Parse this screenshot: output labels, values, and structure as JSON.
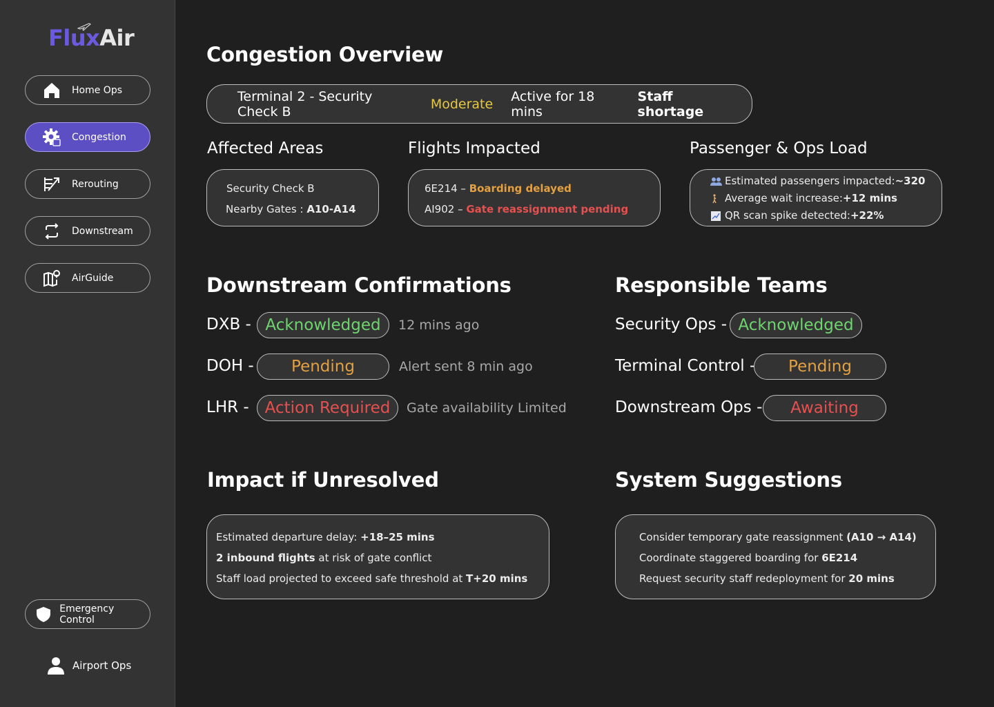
{
  "brand": {
    "flux": "Flux",
    "air": "Air"
  },
  "nav": {
    "home": "Home Ops",
    "congestion": "Congestion",
    "rerouting": "Rerouting",
    "downstream": "Downstream",
    "airguide": "AirGuide",
    "emergency": "Emergency Control",
    "user": "Airport Ops"
  },
  "page_title": "Congestion Overview",
  "status": {
    "location": "Terminal 2 - Security Check B",
    "level": "Moderate",
    "duration": "Active for 18 mins",
    "cause": "Staff shortage"
  },
  "affected": {
    "title": "Affected Areas",
    "line1": "Security Check B",
    "gates_label": "Nearby Gates : ",
    "gates_value": "A10-A14"
  },
  "flights": {
    "title": "Flights Impacted",
    "f1_code": "6E214 – ",
    "f1_status": "Boarding delayed",
    "f2_code": "AI902 – ",
    "f2_status": "Gate reassignment pending"
  },
  "load": {
    "title": "Passenger & Ops Load",
    "l1_label": "Estimated passengers impacted: ",
    "l1_value": "~320",
    "l2_label": "Average wait increase: ",
    "l2_value": "+12 mins",
    "l3_label": "QR scan spike detected: ",
    "l3_value": "+22%"
  },
  "downstream": {
    "title": "Downstream Confirmations",
    "rows": [
      {
        "code": "DXB -",
        "status": "Acknowledged",
        "note": "12 mins ago"
      },
      {
        "code": "DOH -",
        "status": "Pending",
        "note": "Alert sent 8 min ago"
      },
      {
        "code": "LHR -",
        "status": "Action Required",
        "note": "Gate availability Limited"
      }
    ]
  },
  "teams": {
    "title": "Responsible Teams",
    "rows": [
      {
        "name": "Security Ops -",
        "status": "Acknowledged"
      },
      {
        "name": "Terminal Control -",
        "status": "Pending"
      },
      {
        "name": "Downstream Ops -",
        "status": "Awaiting"
      }
    ]
  },
  "impact": {
    "title": "Impact if Unresolved",
    "l1_label": "Estimated departure delay: ",
    "l1_value": "+18–25 mins",
    "l2_value": "2 inbound flights",
    "l2_label": " at risk of gate conflict",
    "l3_label": "Staff load projected to exceed safe threshold at ",
    "l3_value": "T+20 mins"
  },
  "suggestions": {
    "title": "System Suggestions",
    "l1_label": "Consider temporary gate reassignment ",
    "l1_value": "(A10 → A14)",
    "l2_label": "Coordinate staggered boarding for ",
    "l2_value": "6E214",
    "l3_label": "Request security staff redeployment for ",
    "l3_value": "20 mins"
  },
  "colors": {
    "accent": "#5c4fc4",
    "brand": "#6a5ae0",
    "moderate": "#e6c93e",
    "pending": "#e3a043",
    "alert": "#e55050",
    "ok": "#6fd46f"
  }
}
